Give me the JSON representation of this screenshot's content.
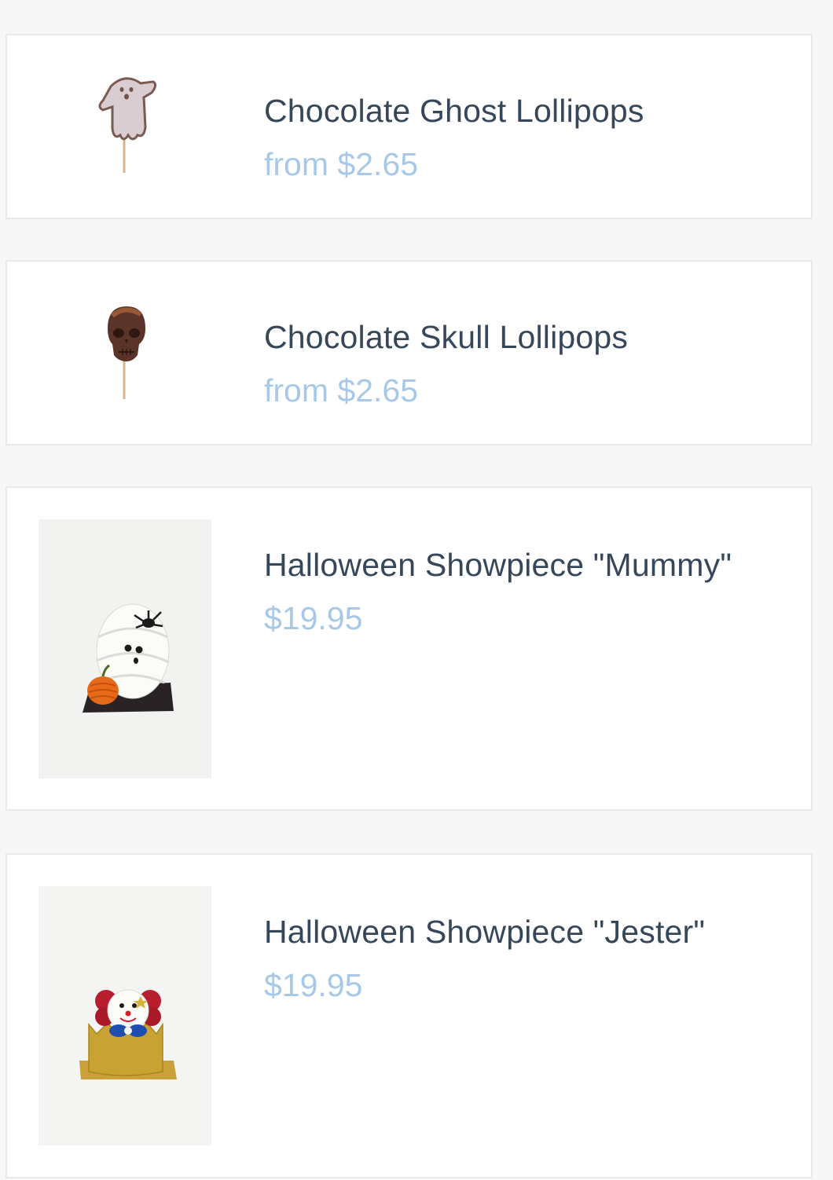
{
  "products": [
    {
      "name": "Chocolate Ghost Lollipops",
      "price": "from $2.65",
      "image_icon": "ghost-lollipop-icon"
    },
    {
      "name": "Chocolate Skull Lollipops",
      "price": "from $2.65",
      "image_icon": "skull-lollipop-icon"
    },
    {
      "name": "Halloween Showpiece \"Mummy\"",
      "price": "$19.95",
      "image_icon": "mummy-showpiece-icon"
    },
    {
      "name": "Halloween Showpiece \"Jester\"",
      "price": "$19.95",
      "image_icon": "jester-showpiece-icon"
    }
  ],
  "colors": {
    "title": "#37475a",
    "price": "#a8c8e8",
    "card_border": "#e9e9e9",
    "background": "#f7f7f7"
  }
}
